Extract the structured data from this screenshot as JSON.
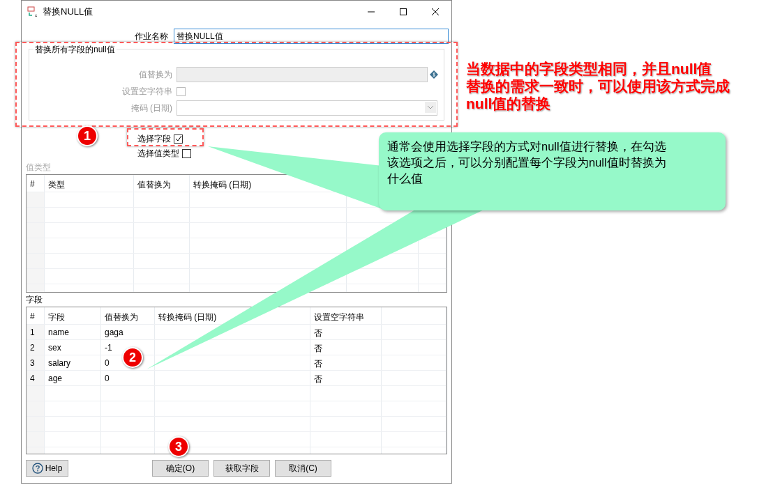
{
  "window": {
    "title": "替换NULL值"
  },
  "job_name": {
    "label": "作业名称",
    "value": "替换NULL值"
  },
  "replace_all": {
    "title": "替换所有字段的null值",
    "disabled": true,
    "replace_label": "值替换为",
    "empty_label": "设置空字符串",
    "empty_checked": false,
    "mask_label": "掩码 (日期)"
  },
  "options": [
    {
      "label": "选择字段",
      "checked": true
    },
    {
      "label": "选择值类型",
      "checked": false
    }
  ],
  "value_types": {
    "label": "值类型",
    "disabled": true,
    "columns": [
      "#",
      "类型",
      "值替换为",
      "转换掩码 (日期)"
    ]
  },
  "fields": {
    "label": "字段",
    "columns": [
      "#",
      "字段",
      "值替换为",
      "转换掩码 (日期)",
      "设置空字符串"
    ],
    "rows": [
      {
        "num": "1",
        "field": "name",
        "value": "gaga",
        "empty": "否"
      },
      {
        "num": "2",
        "field": "sex",
        "value": "-1",
        "empty": "否"
      },
      {
        "num": "3",
        "field": "salary",
        "value": "0",
        "empty": "否"
      },
      {
        "num": "4",
        "field": "age",
        "value": "0",
        "empty": "否"
      }
    ]
  },
  "buttons": [
    {
      "kind": "help",
      "label": "Help"
    },
    {
      "kind": "plain",
      "label": "确定(O)"
    },
    {
      "kind": "plain",
      "label": "获取字段"
    },
    {
      "kind": "plain",
      "label": "取消(C)"
    }
  ],
  "annotations": {
    "note": [
      "当数据中的字段类型相同，并且null值",
      "替换的需求一致时，可以使用该方式完成",
      "null值的替换"
    ],
    "callout": [
      "通常会使用选择字段的方式对null值进行替换，在勾选",
      "该选项之后，可以分别配置每个字段为null值时替换为",
      "什么值"
    ],
    "markers": [
      "1",
      "2",
      "3"
    ]
  }
}
